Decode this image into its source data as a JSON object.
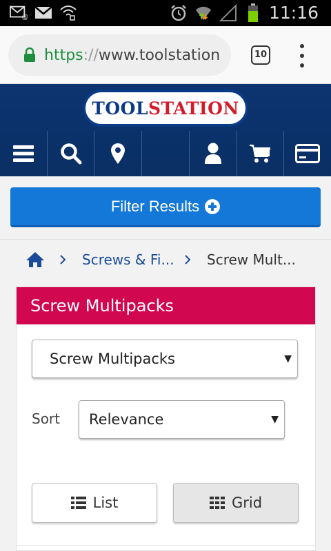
{
  "status_bar": {
    "time": "11:16",
    "icons": [
      "mail-at-icon",
      "gmail-icon",
      "wifi-icon",
      "alarm-icon",
      "wifi-data-icon",
      "signal-icon",
      "battery-icon"
    ]
  },
  "browser": {
    "url_scheme": "https",
    "url_sep": "://",
    "url_host": "www.toolstation",
    "tab_count": "10"
  },
  "site": {
    "logo_part1": "TOOL",
    "logo_part2": "STATION",
    "nav_icons": [
      "menu-icon",
      "search-icon",
      "location-pin-icon",
      "blank",
      "user-icon",
      "cart-icon",
      "card-icon"
    ]
  },
  "filter": {
    "label": "Filter Results"
  },
  "breadcrumb": {
    "link": "Screws & Fi...",
    "current": "Screw Mult..."
  },
  "panel": {
    "title": "Screw Multipacks",
    "category_select": "Screw Multipacks",
    "sort_label": "Sort",
    "sort_select": "Relevance",
    "list_label": "List",
    "grid_label": "Grid"
  },
  "colors": {
    "header_blue": "#0c3470",
    "filter_blue": "#1478d8",
    "panel_head": "#d1074f",
    "link_blue": "#1a4b9b"
  }
}
